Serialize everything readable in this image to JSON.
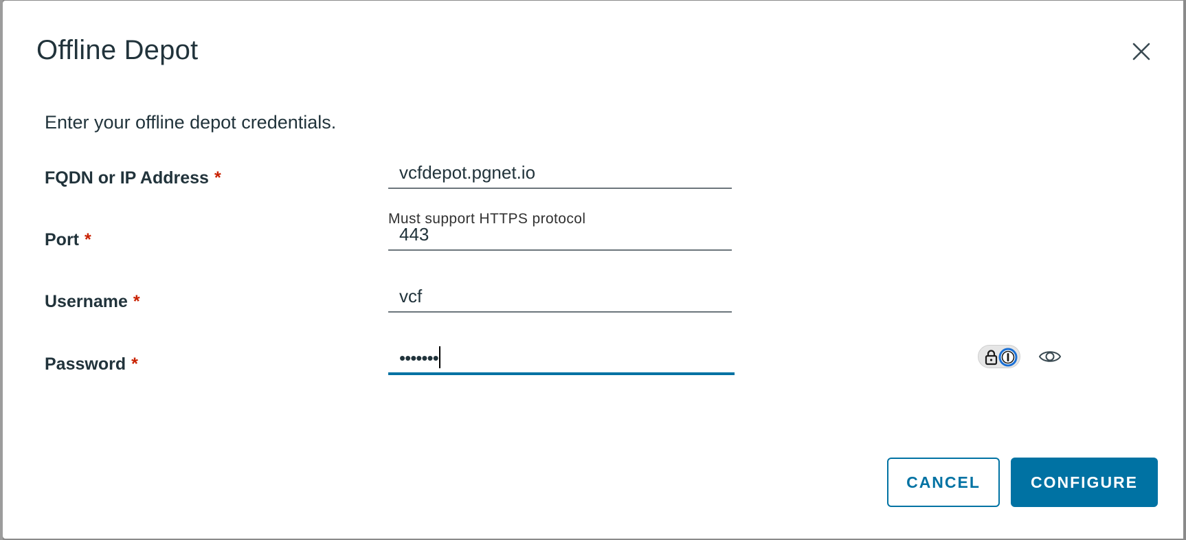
{
  "dialog": {
    "title": "Offline Depot",
    "subtitle": "Enter your offline depot credentials."
  },
  "fields": {
    "fqdn": {
      "label": "FQDN or IP Address",
      "required_marker": "*",
      "value": "vcfdepot.pgnet.io",
      "helper": "Must support HTTPS protocol"
    },
    "port": {
      "label": "Port",
      "required_marker": "*",
      "value": "443"
    },
    "username": {
      "label": "Username",
      "required_marker": "*",
      "value": "vcf"
    },
    "password": {
      "label": "Password",
      "required_marker": "*",
      "masked_value": "•••••••",
      "focused": true
    }
  },
  "buttons": {
    "cancel_label": "CANCEL",
    "configure_label": "CONFIGURE"
  },
  "icons": {
    "close": "close-icon",
    "password_manager": "password-manager-icon",
    "reveal_password": "eye-icon"
  },
  "colors": {
    "primary": "#0072a3",
    "required": "#c92100",
    "text": "#21333b"
  }
}
